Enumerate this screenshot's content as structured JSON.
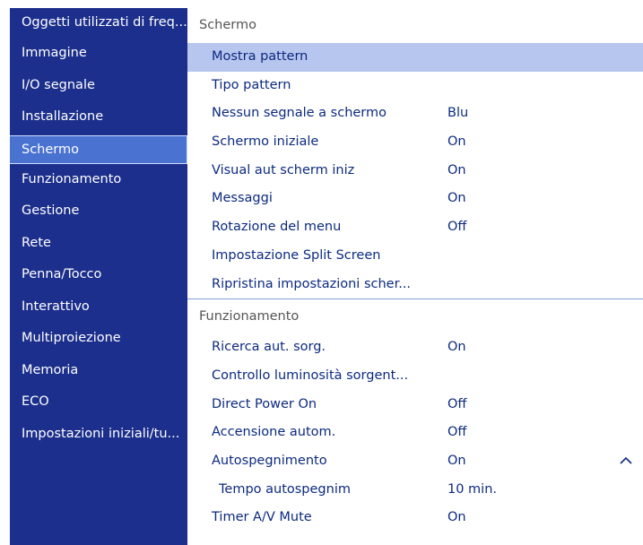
{
  "sidebar": {
    "items": [
      {
        "label": "Oggetti utilizzati di freq..."
      },
      {
        "label": "Immagine"
      },
      {
        "label": "I/O segnale"
      },
      {
        "label": "Installazione"
      },
      {
        "label": "Schermo"
      },
      {
        "label": "Funzionamento"
      },
      {
        "label": "Gestione"
      },
      {
        "label": "Rete"
      },
      {
        "label": "Penna/Tocco"
      },
      {
        "label": "Interattivo"
      },
      {
        "label": "Multiproiezione"
      },
      {
        "label": "Memoria"
      },
      {
        "label": "ECO"
      },
      {
        "label": "Impostazioni iniziali/tu..."
      }
    ],
    "active": "Schermo"
  },
  "main": {
    "section1": {
      "title": "Schermo",
      "rows": [
        {
          "label": "Mostra pattern",
          "value": ""
        },
        {
          "label": "Tipo pattern",
          "value": ""
        },
        {
          "label": "Nessun segnale a schermo",
          "value": "Blu"
        },
        {
          "label": "Schermo iniziale",
          "value": "On"
        },
        {
          "label": "Visual aut scherm iniz",
          "value": "On"
        },
        {
          "label": "Messaggi",
          "value": "On"
        },
        {
          "label": "Rotazione del menu",
          "value": "Off"
        },
        {
          "label": "Impostazione Split Screen",
          "value": ""
        },
        {
          "label": "Ripristina impostazioni scher...",
          "value": ""
        }
      ]
    },
    "section2": {
      "title": "Funzionamento",
      "rows": [
        {
          "label": "Ricerca aut. sorg.",
          "value": "On"
        },
        {
          "label": "Controllo luminosità sorgent...",
          "value": ""
        },
        {
          "label": "Direct Power On",
          "value": "Off"
        },
        {
          "label": "Accensione autom.",
          "value": "Off"
        },
        {
          "label": "Autospegnimento",
          "value": "On"
        },
        {
          "label": "Tempo autospegnim",
          "value": "10 min."
        },
        {
          "label": "Timer A/V Mute",
          "value": "On"
        }
      ]
    }
  },
  "colors": {
    "sidebar_bg": "#1c2f8c",
    "sidebar_active": "#4a73d1",
    "selected_row": "#b7c6ee",
    "text_primary": "#0c2a80"
  },
  "icons": {
    "expand": "chevron-up-icon"
  }
}
